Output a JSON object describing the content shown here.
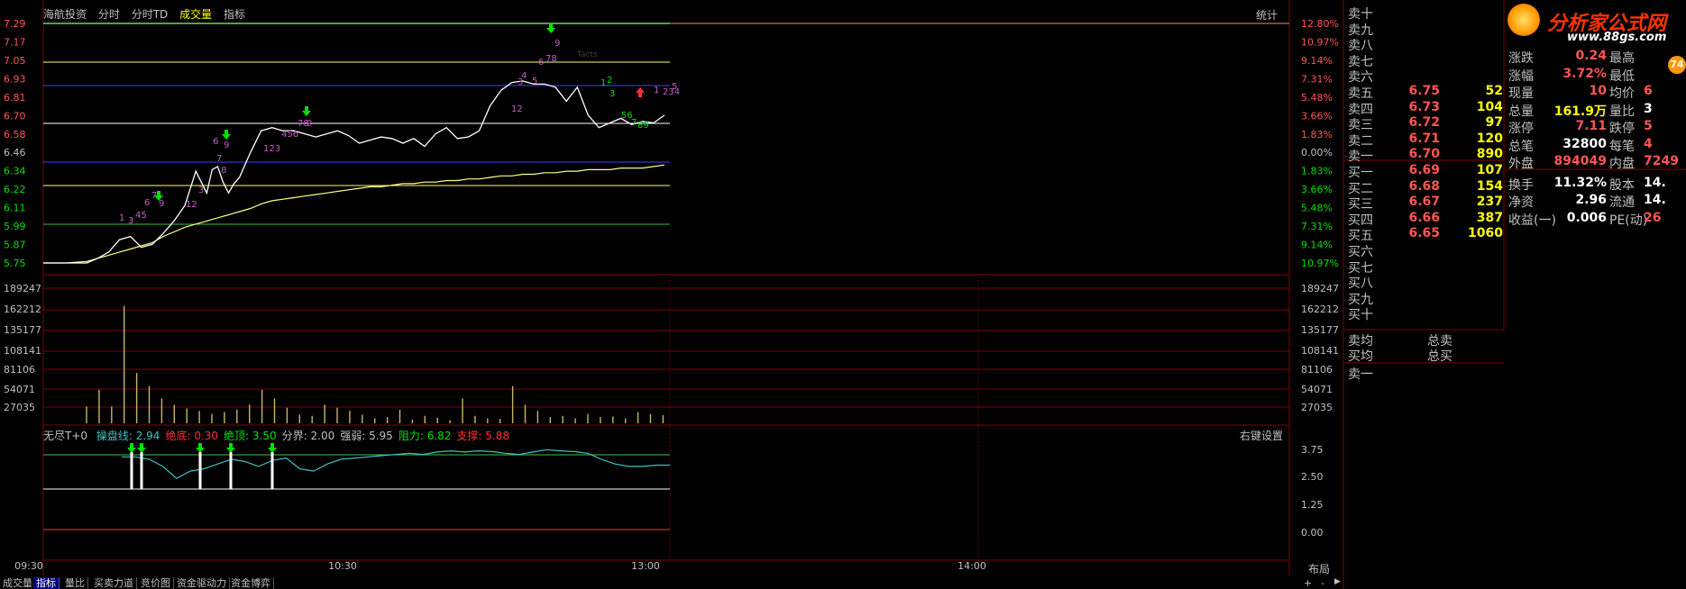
{
  "colors": {
    "up": "#ff5555",
    "down": "#00e000",
    "price_line": "#ffffff",
    "avg_line": "#ffff80",
    "vol_bar": "#c8b468",
    "grid_red": "#800000",
    "title_yellow": "#ffff00",
    "cyan": "#40c0c0"
  },
  "header": {
    "stock_name": "海航投资",
    "tabs": [
      "分时",
      "分时TD",
      "成交量",
      "指标"
    ],
    "stats_button": "统计"
  },
  "left_axis": {
    "price_ticks": [
      "7.29",
      "7.17",
      "7.05",
      "6.93",
      "6.81",
      "6.70",
      "6.58",
      "6.46",
      "6.34",
      "6.22",
      "6.11",
      "5.99",
      "5.87",
      "5.75"
    ],
    "volume_ticks": [
      "189247",
      "162212",
      "135177",
      "108141",
      "81106",
      "54071",
      "27035"
    ]
  },
  "right_axis": {
    "pct_ticks": [
      "12.80%",
      "10.97%",
      "9.14%",
      "7.31%",
      "5.48%",
      "3.66%",
      "1.83%",
      "0.00%",
      "1.83%",
      "3.66%",
      "5.48%",
      "7.31%",
      "9.14%",
      "10.97%"
    ],
    "volume_ticks": [
      "189247",
      "162212",
      "135177",
      "108141",
      "81106",
      "54071",
      "27035"
    ],
    "indicator_ticks": [
      "3.75",
      "2.50",
      "1.25",
      "0.00"
    ]
  },
  "indicator": {
    "name": "无尽T+0",
    "items": [
      {
        "label": "操盘线:",
        "value": "2.94",
        "color": "#40c0c0"
      },
      {
        "label": "绝底:",
        "value": "0.30",
        "color": "#ff3030"
      },
      {
        "label": "绝顶:",
        "value": "3.50",
        "color": "#00e000"
      },
      {
        "label": "分界:",
        "value": "2.00",
        "color": "#c0c0c0"
      },
      {
        "label": "强弱:",
        "value": "5.95",
        "color": "#c0c0c0"
      },
      {
        "label": "阻力:",
        "value": "6.82",
        "color": "#00e000"
      },
      {
        "label": "支撑:",
        "value": "5.88",
        "color": "#ff3030"
      }
    ],
    "settings": "右键设置"
  },
  "time_axis": [
    "09:30",
    "10:30",
    "13:00",
    "14:00"
  ],
  "layout_button": "布局",
  "bottom_tabs": [
    "成交量",
    "指标",
    "量比",
    "买卖力道",
    "竞价图",
    "资金驱动力",
    "资金博弈"
  ],
  "chart_data": {
    "type": "line",
    "ylim": [
      5.75,
      7.29
    ],
    "price_x": [
      0,
      20,
      40,
      50,
      60,
      70,
      80,
      90,
      100,
      110,
      120,
      130,
      140,
      150,
      155,
      160,
      165,
      170,
      175,
      180,
      190,
      200,
      210,
      220,
      230,
      240,
      250,
      260,
      270,
      280,
      290,
      300,
      310,
      320,
      330,
      340,
      350,
      360,
      370,
      380,
      390,
      400,
      410,
      420,
      430,
      440,
      450,
      460,
      470,
      480,
      490,
      500,
      510,
      520,
      530,
      540,
      550,
      560,
      570
    ],
    "price": [
      5.75,
      5.75,
      5.75,
      5.78,
      5.82,
      5.9,
      5.92,
      5.85,
      5.87,
      5.94,
      6.02,
      6.12,
      6.34,
      6.2,
      6.35,
      6.37,
      6.27,
      6.2,
      6.26,
      6.3,
      6.46,
      6.6,
      6.62,
      6.6,
      6.6,
      6.58,
      6.56,
      6.58,
      6.6,
      6.57,
      6.52,
      6.54,
      6.56,
      6.55,
      6.52,
      6.55,
      6.5,
      6.58,
      6.62,
      6.55,
      6.56,
      6.6,
      6.76,
      6.86,
      6.91,
      6.92,
      6.9,
      6.9,
      6.88,
      6.79,
      6.88,
      6.7,
      6.62,
      6.65,
      6.68,
      6.64,
      6.66,
      6.65,
      6.7
    ],
    "avg": [
      5.75,
      5.75,
      5.76,
      5.78,
      5.8,
      5.82,
      5.84,
      5.86,
      5.88,
      5.92,
      5.95,
      5.98,
      6.0,
      6.02,
      6.03,
      6.04,
      6.05,
      6.06,
      6.07,
      6.08,
      6.1,
      6.13,
      6.15,
      6.16,
      6.17,
      6.18,
      6.19,
      6.2,
      6.21,
      6.22,
      6.23,
      6.24,
      6.24,
      6.25,
      6.26,
      6.26,
      6.27,
      6.27,
      6.28,
      6.28,
      6.29,
      6.29,
      6.3,
      6.31,
      6.31,
      6.32,
      6.32,
      6.33,
      6.33,
      6.34,
      6.34,
      6.35,
      6.35,
      6.35,
      6.36,
      6.36,
      6.36,
      6.37,
      6.38
    ],
    "volume": [
      27035,
      54071,
      27035,
      189247,
      81106,
      60000,
      40000,
      30000,
      24000,
      20000,
      15000,
      18000,
      22000,
      30000,
      54071,
      40000,
      25000,
      14000,
      12000,
      30000,
      25000,
      20000,
      14000,
      8000,
      10000,
      22000,
      6000,
      12000,
      9000,
      5000,
      40000,
      12000,
      8000,
      7000,
      60000,
      30000,
      20000,
      10000,
      12000,
      8000,
      15000,
      10000,
      11000,
      8000,
      18000,
      15000,
      13000,
      10000,
      9000,
      14000,
      8000,
      7000,
      12000,
      11000,
      8000,
      30000,
      20000,
      10000,
      12000,
      5000
    ],
    "indicator_series": [
      3.5,
      3.5,
      3.4,
      3.1,
      2.6,
      2.9,
      3.0,
      3.2,
      3.4,
      3.3,
      3.1,
      3.35,
      3.45,
      3.0,
      2.9,
      3.2,
      3.4,
      3.45,
      3.5,
      3.55,
      3.6,
      3.65,
      3.6,
      3.7,
      3.75,
      3.7,
      3.75,
      3.72,
      3.65,
      3.6,
      3.7,
      3.8,
      3.75,
      3.72,
      3.65,
      3.4,
      3.2,
      3.1,
      3.1,
      3.15,
      3.15
    ]
  },
  "order_book": {
    "sell": [
      {
        "label": "卖十",
        "price": "",
        "vol": ""
      },
      {
        "label": "卖九",
        "price": "",
        "vol": ""
      },
      {
        "label": "卖八",
        "price": "",
        "vol": ""
      },
      {
        "label": "卖七",
        "price": "",
        "vol": ""
      },
      {
        "label": "卖六",
        "price": "",
        "vol": ""
      },
      {
        "label": "卖五",
        "price": "6.75",
        "vol": "52"
      },
      {
        "label": "卖四",
        "price": "6.73",
        "vol": "104"
      },
      {
        "label": "卖三",
        "price": "6.72",
        "vol": "97"
      },
      {
        "label": "卖二",
        "price": "6.71",
        "vol": "120"
      },
      {
        "label": "卖一",
        "price": "6.70",
        "vol": "890"
      }
    ],
    "buy": [
      {
        "label": "买一",
        "price": "6.69",
        "vol": "107"
      },
      {
        "label": "买二",
        "price": "6.68",
        "vol": "154"
      },
      {
        "label": "买三",
        "price": "6.67",
        "vol": "237"
      },
      {
        "label": "买四",
        "price": "6.66",
        "vol": "387"
      },
      {
        "label": "买五",
        "price": "6.65",
        "vol": "1060"
      },
      {
        "label": "买六",
        "price": "",
        "vol": ""
      },
      {
        "label": "买七",
        "price": "",
        "vol": ""
      },
      {
        "label": "买八",
        "price": "",
        "vol": ""
      },
      {
        "label": "买九",
        "price": "",
        "vol": ""
      },
      {
        "label": "买十",
        "price": "",
        "vol": ""
      }
    ],
    "avg_sell": "卖均",
    "total_sell": "总卖",
    "avg_buy": "买均",
    "total_buy": "总买",
    "sell_one": "卖一"
  },
  "stats": [
    {
      "k": "涨跌",
      "v": "0.24",
      "vc": "#ff5555",
      "k2": "最高",
      "v2": ""
    },
    {
      "k": "涨幅",
      "v": "3.72%",
      "vc": "#ff5555",
      "k2": "最低",
      "v2": ""
    },
    {
      "k": "现量",
      "v": "10",
      "vc": "#ff5555",
      "k2": "均价",
      "v2": "6"
    },
    {
      "k": "总量",
      "v": "161.9万",
      "vc": "#ffff00",
      "k2": "量比",
      "v2": "3"
    },
    {
      "k": "涨停",
      "v": "7.11",
      "vc": "#ff5555",
      "k2": "跌停",
      "v2": "5"
    },
    {
      "k": "总笔",
      "v": "32800",
      "vc": "#ffffff",
      "k2": "每笔",
      "v2": "4"
    },
    {
      "k": "外盘",
      "v": "894049",
      "vc": "#ff5555",
      "k2": "内盘",
      "v2": "7249"
    },
    {
      "k": "换手",
      "v": "11.32%",
      "vc": "#ffffff",
      "k2": "股本",
      "v2": "14."
    },
    {
      "k": "净资",
      "v": "2.96",
      "vc": "#ffffff",
      "k2": "流通",
      "v2": "14."
    },
    {
      "k": "收益(一)",
      "v": "0.006",
      "vc": "#ffffff",
      "k2": "PE(动)",
      "v2": "26"
    }
  ],
  "logo": {
    "title": "分析家公式网",
    "url": "www.88gs.com",
    "badge": "74"
  }
}
